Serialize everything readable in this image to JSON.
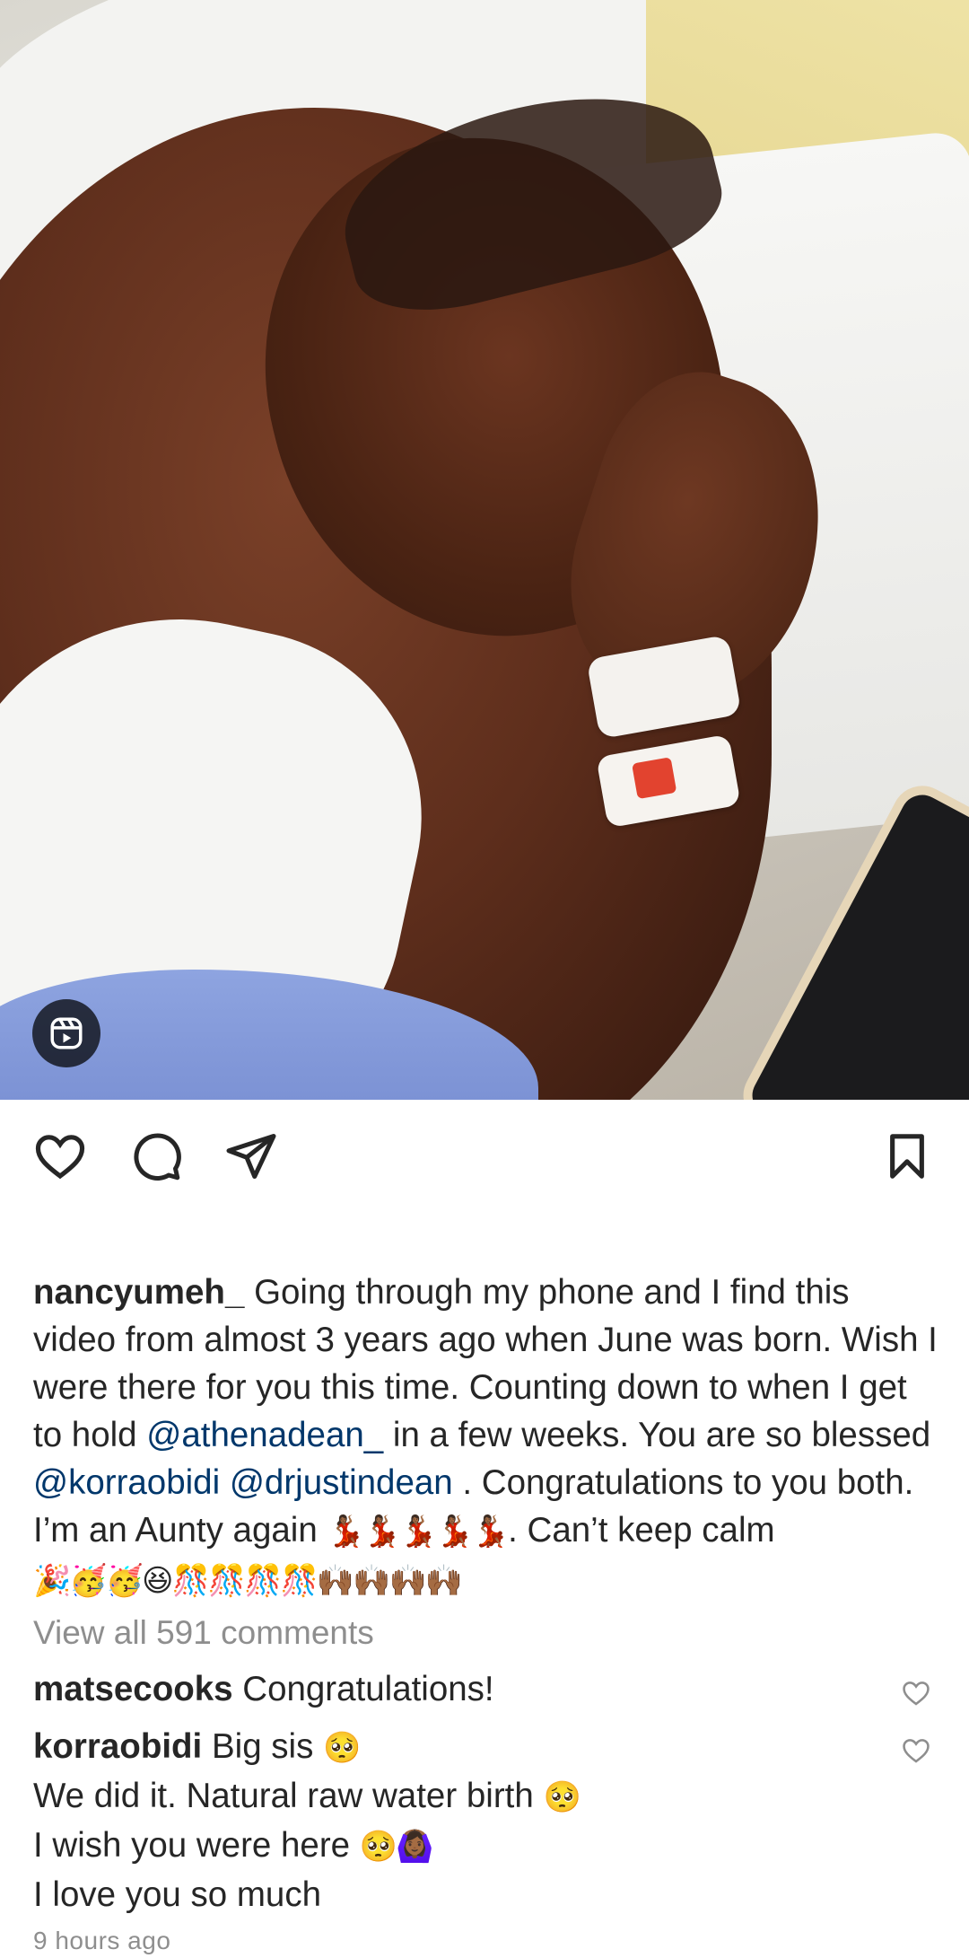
{
  "post": {
    "media_type_icon": "reels-icon",
    "actions": {
      "like_icon": "heart-icon",
      "comment_icon": "comment-bubble-icon",
      "share_icon": "paper-plane-icon",
      "save_icon": "bookmark-icon"
    },
    "caption": {
      "username": "nancyumeh_",
      "text_1": " Going through my phone and I find this video from almost 3 years ago when June was born. Wish I were there for you this time. Counting down to when I get to hold ",
      "mention_1": "@athenadean_",
      "text_2": "  in a few weeks. You are so blessed ",
      "mention_2": "@korraobidi",
      "text_3": " ",
      "mention_3": "@drjustindean",
      "text_4": " . Congratulations to you both. I’m an Aunty again ",
      "emoji_dancers_1": "💃🏾💃🏾💃🏾💃🏾💃🏾",
      "text_5": ". Can’t keep calm ",
      "emoji_party": "🎉🥳🥳😆🎊🎊🎊🎊🙌🏾🙌🏾🙌🏾🙌🏾"
    },
    "view_all_comments": "View all 591 comments",
    "comments": [
      {
        "username": "matsecooks",
        "text": " Congratulations!"
      },
      {
        "username": "korraobidi",
        "line_1": " Big sis ",
        "emoji_1": "🥺",
        "line_2": "We did it. Natural raw water birth ",
        "emoji_2": "🥺",
        "line_3": "I wish you were here ",
        "emoji_3": "🥺🙆🏾‍♀️",
        "line_4": "I love you so much"
      }
    ],
    "timestamp": "9 hours ago"
  },
  "colors": {
    "text": "#262626",
    "mention": "#00376b",
    "muted": "#8e8e8e"
  }
}
